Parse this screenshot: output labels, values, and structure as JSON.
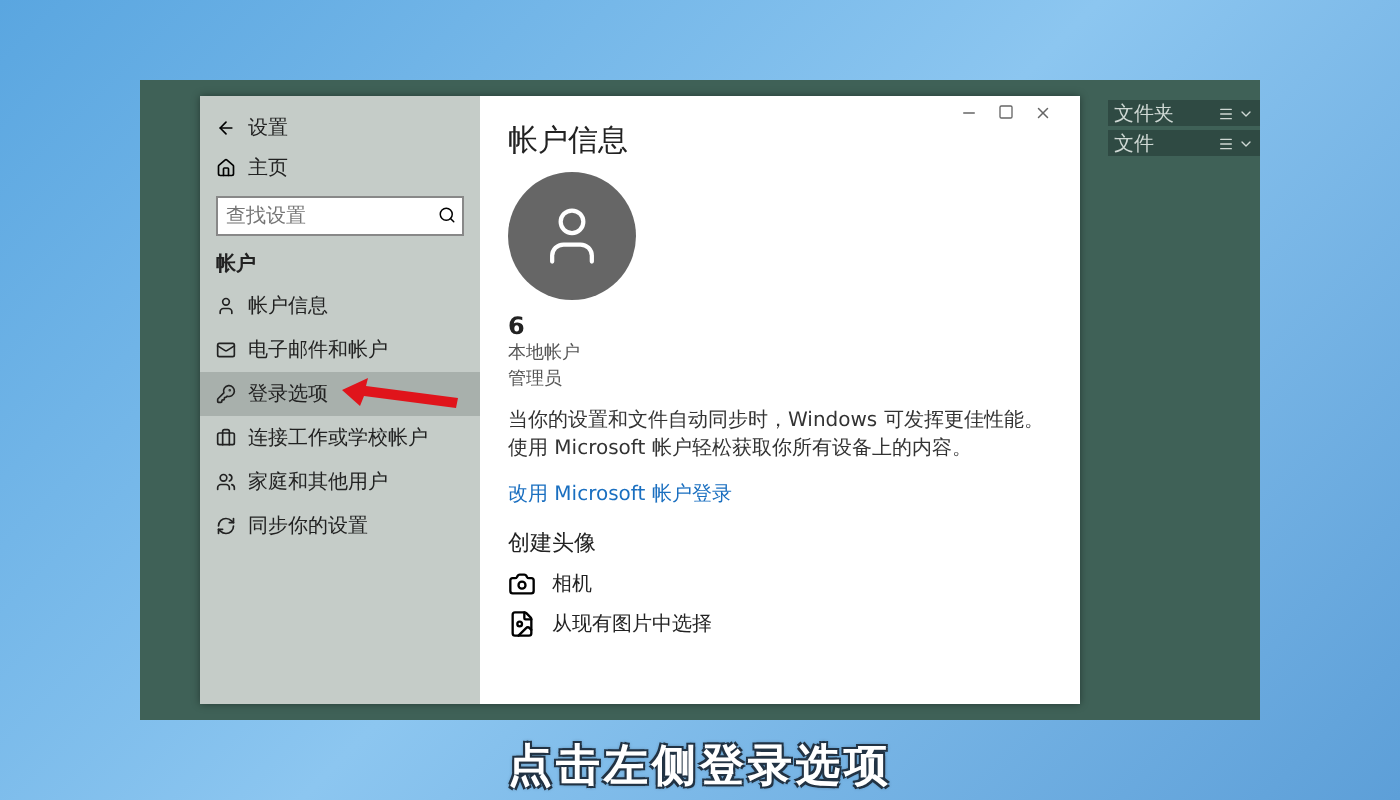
{
  "settings_window": {
    "title": "设置",
    "sidebar": {
      "home": "主页",
      "search": {
        "placeholder": "查找设置"
      },
      "section": "帐户",
      "items": [
        {
          "label": "帐户信息",
          "selected": false
        },
        {
          "label": "电子邮件和帐户",
          "selected": false
        },
        {
          "label": "登录选项",
          "selected": true
        },
        {
          "label": "连接工作或学校帐户",
          "selected": false
        },
        {
          "label": "家庭和其他用户",
          "selected": false
        },
        {
          "label": "同步你的设置",
          "selected": false
        }
      ]
    },
    "main": {
      "heading": "帐户信息",
      "user_name": "6",
      "account_type": "本地帐户",
      "role": "管理员",
      "description": "当你的设置和文件自动同步时，Windows 可发挥更佳性能。使用 Microsoft 帐户轻松获取你所有设备上的内容。",
      "link": "改用 Microsoft 帐户登录",
      "avatar_section": "创建头像",
      "avatar_options": [
        {
          "label": "相机"
        },
        {
          "label": "从现有图片中选择"
        }
      ]
    }
  },
  "desktop_widgets": [
    {
      "label": "文件夹"
    },
    {
      "label": "文件"
    }
  ],
  "caption": "点击左侧登录选项"
}
